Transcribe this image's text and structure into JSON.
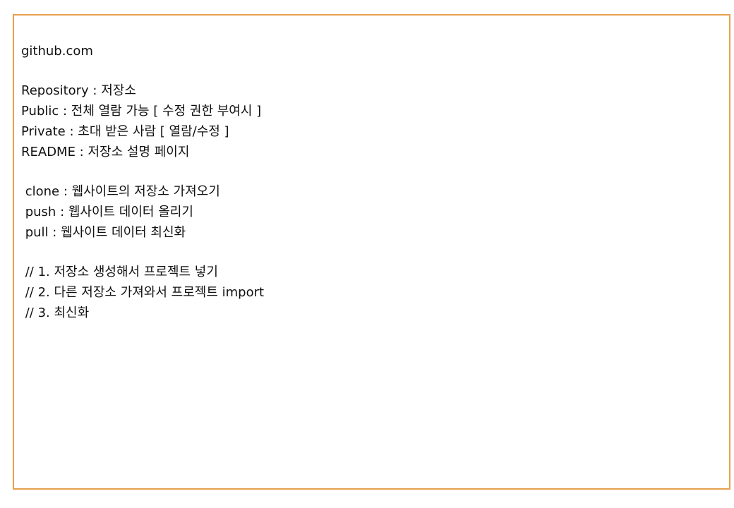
{
  "colors": {
    "border": "#e8a050",
    "text": "#111111",
    "background": "#ffffff"
  },
  "note": {
    "site": "github.com",
    "definitions": [
      "Repository : 저장소",
      "Public : 전체 열람 가능 [ 수정 권한 부여시 ]",
      "Private : 초대 받은 사람 [ 열람/수정 ]",
      "README : 저장소 설명 페이지"
    ],
    "commands": [
      " clone : 웹사이트의 저장소 가져오기",
      " push : 웹사이트 데이터 올리기",
      " pull : 웹사이트 데이터 최신화"
    ],
    "steps": [
      " // 1. 저장소 생성해서 프로젝트 넣기",
      " // 2. 다른 저장소 가져와서 프로젝트 import",
      " // 3. 최신화"
    ]
  }
}
